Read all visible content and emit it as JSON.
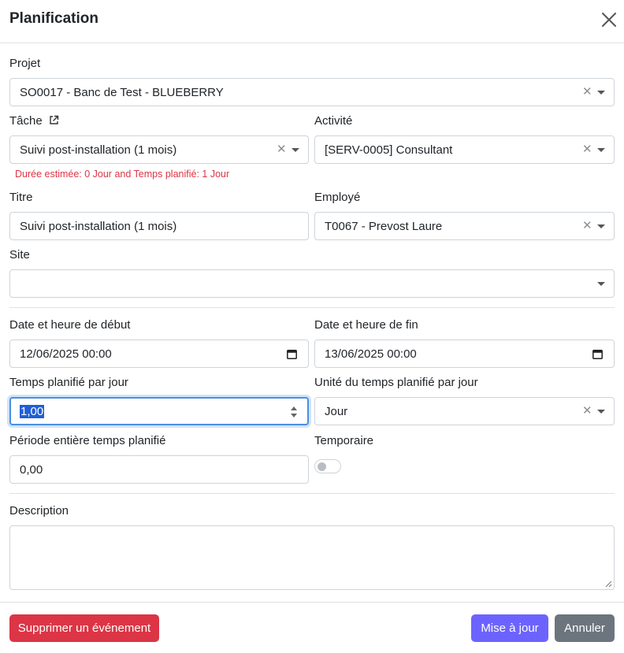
{
  "dialog": {
    "title": "Planification"
  },
  "projet": {
    "label": "Projet",
    "value": "SO0017 - Banc de Test - BLUEBERRY"
  },
  "tache": {
    "label": "Tâche",
    "value": "Suivi post-installation (1 mois)",
    "hint": "Durée estimée: 0 Jour and Temps planifié: 1 Jour"
  },
  "activite": {
    "label": "Activité",
    "value": "[SERV-0005] Consultant"
  },
  "titre": {
    "label": "Titre",
    "value": "Suivi post-installation (1 mois)"
  },
  "employe": {
    "label": "Employé",
    "value": "T0067 - Prevost Laure"
  },
  "site": {
    "label": "Site",
    "value": ""
  },
  "date_debut": {
    "label": "Date et heure de début",
    "value": "12/06/2025 00:00"
  },
  "date_fin": {
    "label": "Date et heure de fin",
    "value": "13/06/2025 00:00"
  },
  "temps_jour": {
    "label": "Temps planifié par jour",
    "value": "1,00"
  },
  "unite": {
    "label": "Unité du temps planifié par jour",
    "value": "Jour"
  },
  "periode": {
    "label": "Période entière temps planifié",
    "value": "0,00"
  },
  "temporaire": {
    "label": "Temporaire",
    "checked": false
  },
  "description": {
    "label": "Description",
    "value": ""
  },
  "buttons": {
    "delete": "Supprimer un événement",
    "update": "Mise à jour",
    "cancel": "Annuler"
  },
  "colors": {
    "delete": "#dc3545",
    "update": "#6c63ff",
    "cancel": "#6c757d",
    "hint": "#dc3545",
    "focus": "#4a90e2"
  },
  "icons": {
    "close": "close-icon",
    "external": "external-link-icon",
    "clear": "clear-icon",
    "caret": "chevron-down-icon",
    "calendar": "calendar-icon",
    "spinner": "spinner-icon",
    "resize": "resize-grip-icon"
  }
}
